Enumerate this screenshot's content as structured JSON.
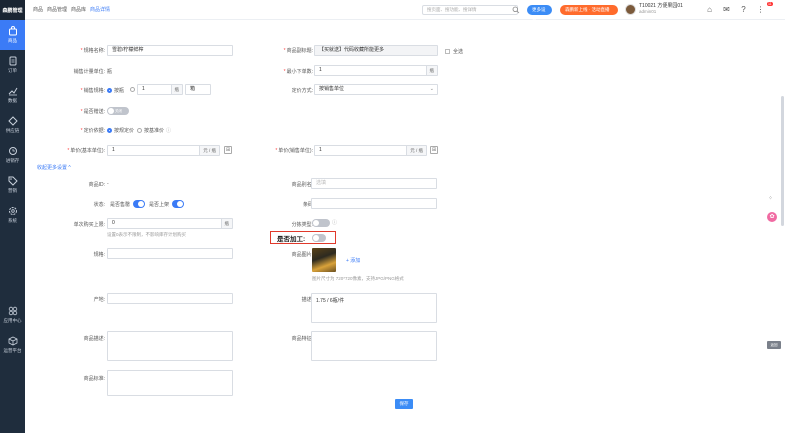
{
  "sidebar": {
    "logo": "森鹏管理",
    "items": [
      {
        "label": "商品",
        "icon": "bag-icon"
      },
      {
        "label": "订单",
        "icon": "order-icon"
      },
      {
        "label": "数据",
        "icon": "chart-icon"
      },
      {
        "label": "供应链",
        "icon": "supply-icon"
      },
      {
        "label": "进销存",
        "icon": "stock-icon"
      },
      {
        "label": "营销",
        "icon": "tag-icon"
      },
      {
        "label": "系统",
        "icon": "gear-icon"
      }
    ],
    "bottom": [
      {
        "label": "应用中心",
        "icon": "apps-icon"
      },
      {
        "label": "运营平台",
        "icon": "cube-icon"
      }
    ]
  },
  "topbar": {
    "breadcrumbs": [
      "商品",
      "商品管理",
      "商品库",
      "商品详情"
    ],
    "search_placeholder": "搜页面、搜功能、搜详情",
    "btn_blue": "更多设置",
    "btn_orange": "森鹏新上线 · 活动直播",
    "user_name": "T10021 方便果园01",
    "user_sub": "admin01",
    "badge": "11"
  },
  "form": {
    "name_label": "规格名称:",
    "name_value": "雪碧/柠檬鲜榨",
    "rel_name_label": "商品副标题:",
    "rel_name_value": "【买就送】代码收藏所能更多",
    "check_all": "全选",
    "unit_label": "销售计量单位:",
    "unit_value": "瓶",
    "min_order_label": "最小下单数:",
    "min_order_value": "1",
    "min_order_suffix": "瓶",
    "sale_mode_label": "销售规格:",
    "sale_mode_opt1": "按瓶",
    "sale_mode_qty": "1",
    "sale_mode_unit1": "瓶",
    "sale_mode_unit2": "箱",
    "price_mode_label": "定价方式:",
    "price_mode_value": "按销售单位",
    "open_label": "是否赠送:",
    "open_toggle": "关闭",
    "pricing_label": "定价依据:",
    "pricing_opt1": "按规定价",
    "pricing_opt2": "按基准价",
    "unit_price_label": "单价(基本单位):",
    "unit_price_value": "1",
    "unit_price_suffix": "元 / 瓶",
    "unit_price2_label": "单价(销售单位):",
    "unit_price2_value": "1",
    "unit_price2_suffix": "元 / 瓶",
    "collapse_link": "收起更多设置 ^",
    "code_label": "商品ID:",
    "code_value": "-",
    "alias_label": "商品别名:",
    "alias_placeholder": "选填",
    "status_label": "状态:",
    "status_opt1": "是否售罄",
    "status_opt2": "是否上架",
    "barcode_label": "条码",
    "stock_label": "单次购买上限:",
    "stock_value": "0",
    "stock_suffix": "瓶",
    "stock_help": "设置0表示不限制，不影响库存计划购买",
    "split_label": "分拣类型:",
    "process_label": "是否加工:",
    "spec_label": "规格:",
    "image_label": "商品图片:",
    "upload_label": "+ 添加",
    "image_help": "图片尺寸为 720*720像素，支持JPG/PNG格式",
    "origin_label": "产地:",
    "desc_label": "描述:",
    "desc_value": "1.75 / 6瓶/件",
    "detail_label": "商品描述:",
    "feature_label": "商品特征:",
    "standard_label": "商品标准:",
    "submit": "保存",
    "side_tag": "返回"
  }
}
